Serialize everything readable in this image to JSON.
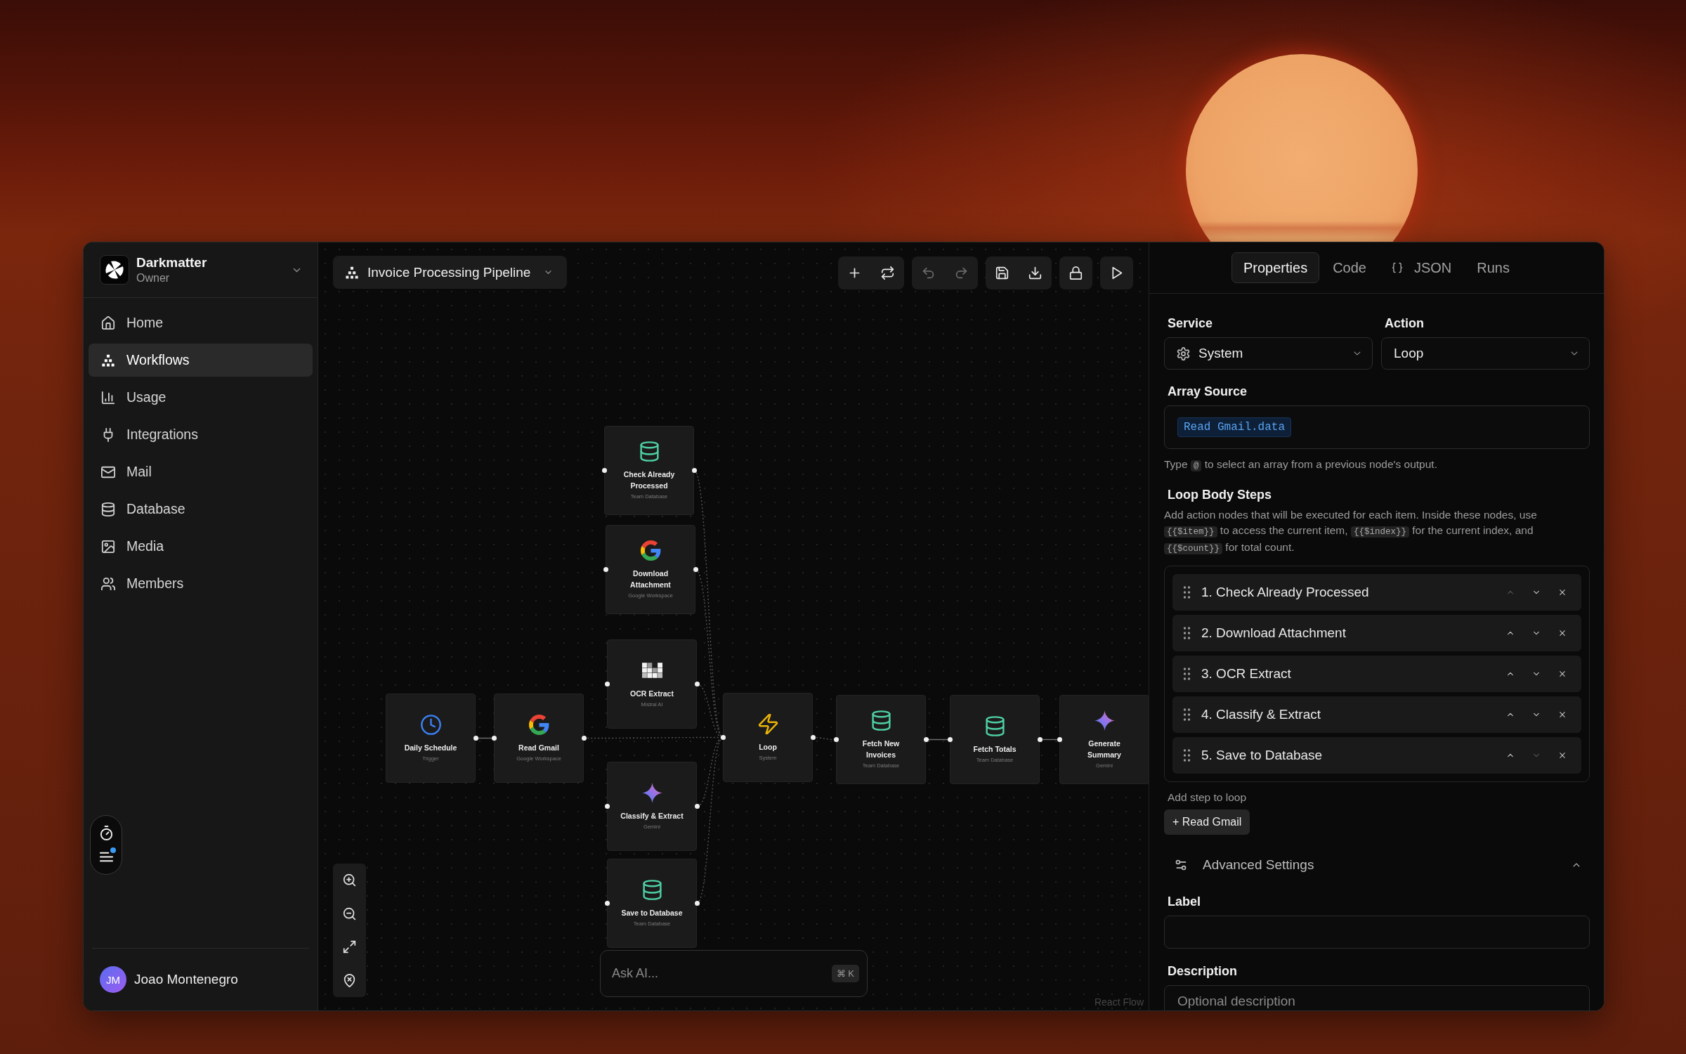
{
  "sidebar": {
    "workspace": {
      "name": "Darkmatter",
      "role": "Owner"
    },
    "nav": [
      {
        "label": "Home",
        "selected": false
      },
      {
        "label": "Workflows",
        "selected": true
      },
      {
        "label": "Usage",
        "selected": false
      },
      {
        "label": "Integrations",
        "selected": false
      },
      {
        "label": "Mail",
        "selected": false
      },
      {
        "label": "Database",
        "selected": false
      },
      {
        "label": "Media",
        "selected": false
      },
      {
        "label": "Members",
        "selected": false
      }
    ],
    "quick_tools": {
      "notification": true
    },
    "user": {
      "initials": "JM",
      "name": "Joao Montenegro"
    }
  },
  "canvas": {
    "workflow_name": "Invoice Processing Pipeline",
    "toolbar": [
      {
        "disabled": false
      },
      {
        "disabled": false
      },
      {
        "disabled": true
      },
      {
        "disabled": true
      },
      {
        "disabled": false
      },
      {
        "disabled": false
      },
      {
        "disabled": false
      },
      {
        "disabled": false
      }
    ],
    "nodes": [
      {
        "title": "Daily Schedule",
        "subtitle": "Trigger",
        "kind": "trigger"
      },
      {
        "title": "Read Gmail",
        "subtitle": "Google Workspace",
        "kind": "google"
      },
      {
        "title": "Check Already Processed",
        "subtitle": "Team Database",
        "kind": "database"
      },
      {
        "title": "Download Attachment",
        "subtitle": "Google Workspace",
        "kind": "google"
      },
      {
        "title": "OCR Extract",
        "subtitle": "Mistral AI",
        "kind": "ocr"
      },
      {
        "title": "Classify & Extract",
        "subtitle": "Gemini",
        "kind": "ai"
      },
      {
        "title": "Save to Database",
        "subtitle": "Team Database",
        "kind": "database"
      },
      {
        "title": "Loop",
        "subtitle": "System",
        "kind": "system"
      },
      {
        "title": "Fetch New Invoices",
        "subtitle": "Team Database",
        "kind": "database"
      },
      {
        "title": "Fetch Totals",
        "subtitle": "Team Database",
        "kind": "database"
      },
      {
        "title": "Generate Summary",
        "subtitle": "Gemini",
        "kind": "ai"
      }
    ],
    "ask_ai": {
      "placeholder": "Ask AI...",
      "shortcut": "⌘ K"
    },
    "attribution": "React Flow"
  },
  "inspector": {
    "tabs": [
      {
        "label": "Properties",
        "selected": true
      },
      {
        "label": "Code",
        "selected": false
      },
      {
        "label": "JSON",
        "selected": false
      },
      {
        "label": "Runs",
        "selected": false
      }
    ],
    "service": {
      "label": "Service",
      "value": "System"
    },
    "action": {
      "label": "Action",
      "value": "Loop"
    },
    "array_source": {
      "label": "Array Source",
      "token": "Read Gmail.data",
      "hint": [
        {
          "kind": "text",
          "text": "Type "
        },
        {
          "kind": "code",
          "text": "@"
        },
        {
          "kind": "text",
          "text": " to select an array from a previous node's output."
        }
      ]
    },
    "loop_body": {
      "title": "Loop Body Steps",
      "description": [
        {
          "kind": "text",
          "text": "Add action nodes that will be executed for each item. Inside these nodes, use "
        },
        {
          "kind": "code",
          "text": "{{$item}}"
        },
        {
          "kind": "text",
          "text": " to access the current item, "
        },
        {
          "kind": "code",
          "text": "{{$index}}"
        },
        {
          "kind": "text",
          "text": " for the current index, and "
        },
        {
          "kind": "code",
          "text": "{{$count}}"
        },
        {
          "kind": "text",
          "text": " for total count."
        }
      ],
      "steps": [
        {
          "label": "1. Check Already Processed",
          "up_disabled": true,
          "down_disabled": false
        },
        {
          "label": "2. Download Attachment",
          "up_disabled": false,
          "down_disabled": false
        },
        {
          "label": "3. OCR Extract",
          "up_disabled": false,
          "down_disabled": false
        },
        {
          "label": "4. Classify & Extract",
          "up_disabled": false,
          "down_disabled": false
        },
        {
          "label": "5. Save to Database",
          "up_disabled": false,
          "down_disabled": true
        }
      ]
    },
    "add_step": {
      "label": "Add step to loop",
      "options": [
        "+ Read Gmail"
      ]
    },
    "advanced": {
      "label": "Advanced Settings",
      "expanded": true,
      "fields": [
        {
          "label": "Label"
        },
        {
          "label": "Description",
          "placeholder": "Optional description"
        }
      ]
    }
  }
}
